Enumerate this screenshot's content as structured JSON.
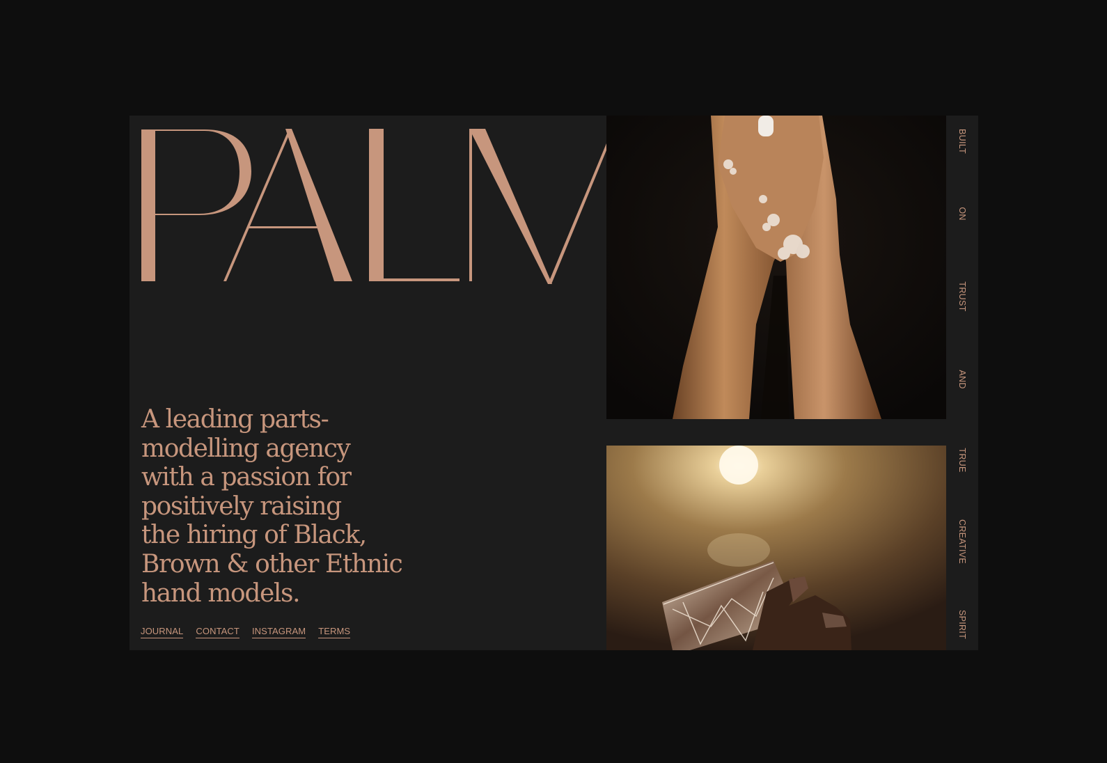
{
  "brand": {
    "wordmark": "PALM",
    "accent_color": "#c7967d",
    "panel_color": "#1c1c1c",
    "background_color": "#0e0e0e"
  },
  "tagline": {
    "lines": [
      "A leading parts-",
      "modelling agency",
      "with a passion for",
      "positively raising",
      "the hiring of Black,",
      "Brown & other Ethnic",
      "hand models."
    ]
  },
  "footer": {
    "links": [
      "JOURNAL",
      "CONTACT",
      "INSTAGRAM",
      "TERMS"
    ]
  },
  "photos": [
    {
      "subject": "soapy hands pressed together"
    },
    {
      "subject": "hand holding cut crystal glass"
    }
  ],
  "motto": {
    "words": [
      "BUILT",
      "ON",
      "TRUST",
      "AND",
      "TRUE",
      "CREATIVE",
      "SPIRIT"
    ]
  }
}
